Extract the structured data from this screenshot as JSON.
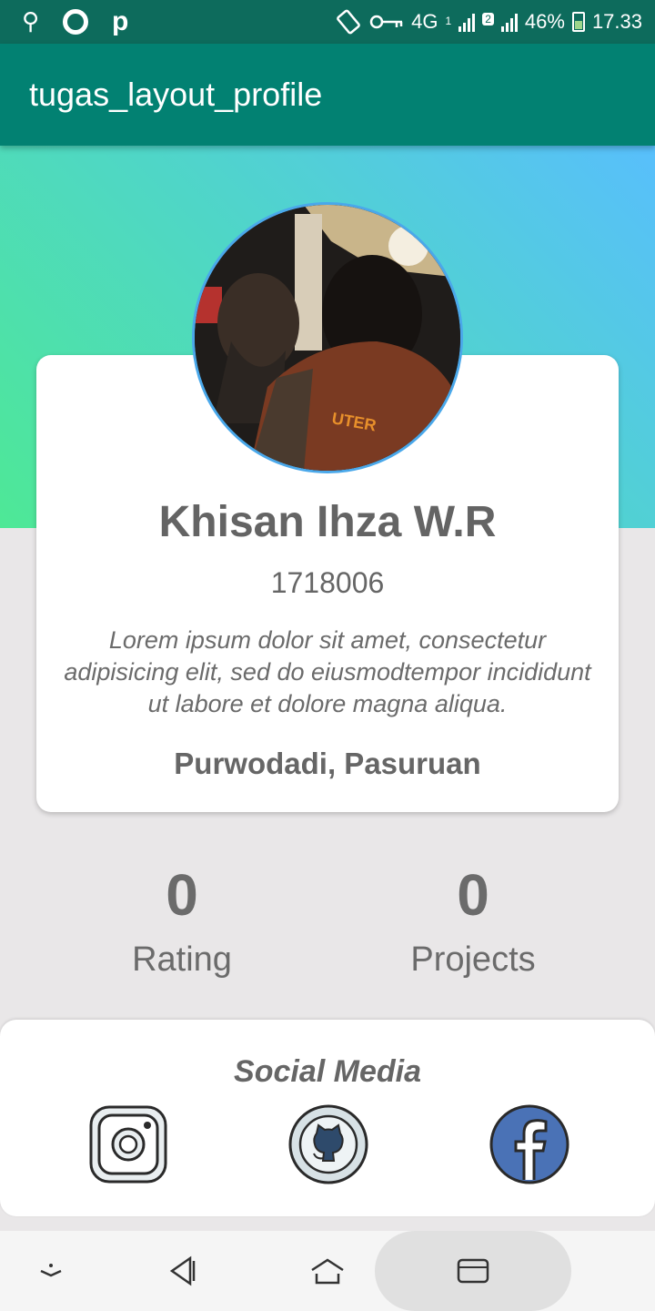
{
  "status_bar": {
    "network": "4G",
    "sim1": "1",
    "sim2": "2",
    "battery": "46%",
    "time": "17.33",
    "icons": [
      "usb-icon",
      "record-icon",
      "p-icon",
      "rotate-icon",
      "vpn-key-icon",
      "signal-icon",
      "battery-icon"
    ]
  },
  "app_bar": {
    "title": "tugas_layout_profile"
  },
  "profile": {
    "name": "Khisan Ihza W.R",
    "id": "1718006",
    "bio": "Lorem ipsum dolor sit amet, consectetur adipisicing elit, sed do eiusmodtempor incididunt ut labore et dolore magna aliqua.",
    "location": "Purwodadi, Pasuruan"
  },
  "stats": {
    "rating_value": "0",
    "rating_label": "Rating",
    "projects_value": "0",
    "projects_label": "Projects"
  },
  "social": {
    "title": "Social Media",
    "icons": [
      "instagram-icon",
      "github-icon",
      "facebook-icon"
    ]
  },
  "colors": {
    "status_bar": "#0d6b5c",
    "app_bar": "#028172",
    "gradient_start": "#4ee896",
    "gradient_end": "#58bffc",
    "background": "#e9e7e8"
  }
}
